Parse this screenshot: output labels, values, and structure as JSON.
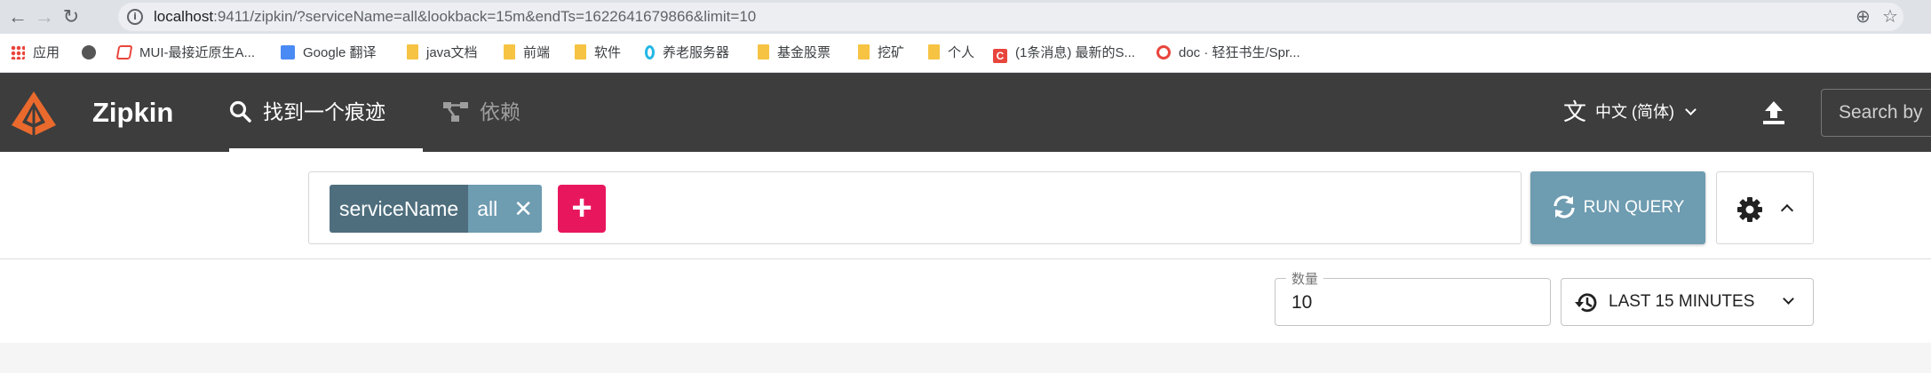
{
  "browser": {
    "url_prefix": "localhost",
    "url_rest": ":9411/zipkin/?serviceName=all&lookback=15m&endTs=1622641679866&limit=10",
    "bookmarks": [
      {
        "icon": "apps-icon",
        "label": "应用"
      },
      {
        "icon": "globe-icon",
        "label": ""
      },
      {
        "icon": "mui-icon",
        "label": "MUI-最接近原生A..."
      },
      {
        "icon": "google-translate-icon",
        "label": "Google 翻译"
      },
      {
        "icon": "folder-icon",
        "label": "java文档"
      },
      {
        "icon": "folder-icon",
        "label": "前端"
      },
      {
        "icon": "folder-icon",
        "label": "软件"
      },
      {
        "icon": "zero-icon",
        "label": "养老服务器"
      },
      {
        "icon": "folder-icon",
        "label": "基金股票"
      },
      {
        "icon": "folder-icon",
        "label": "挖矿"
      },
      {
        "icon": "folder-icon",
        "label": "个人"
      },
      {
        "icon": "csdn-icon",
        "label": "(1条消息) 最新的S..."
      },
      {
        "icon": "gitee-icon",
        "label": "doc · 轻狂书生/Spr..."
      }
    ]
  },
  "header": {
    "brand": "Zipkin",
    "tabs": [
      {
        "label": "找到一个痕迹",
        "icon": "search-icon",
        "active": true
      },
      {
        "label": "依赖",
        "icon": "dependency-icon",
        "active": false
      }
    ],
    "language": "中文 (简体)",
    "search_placeholder": "Search by"
  },
  "query": {
    "chip_key": "serviceName",
    "chip_value": "all",
    "run_label": "RUN QUERY"
  },
  "filters": {
    "limit_label": "数量",
    "limit_value": "10",
    "lookback_label": "LAST 15 MINUTES"
  },
  "colors": {
    "appbar": "#3d3d3d",
    "primary": "#6e9cb1",
    "chip_key": "#4e6e7d",
    "add_button": "#e8175d",
    "logo": "#ea6a2d"
  }
}
